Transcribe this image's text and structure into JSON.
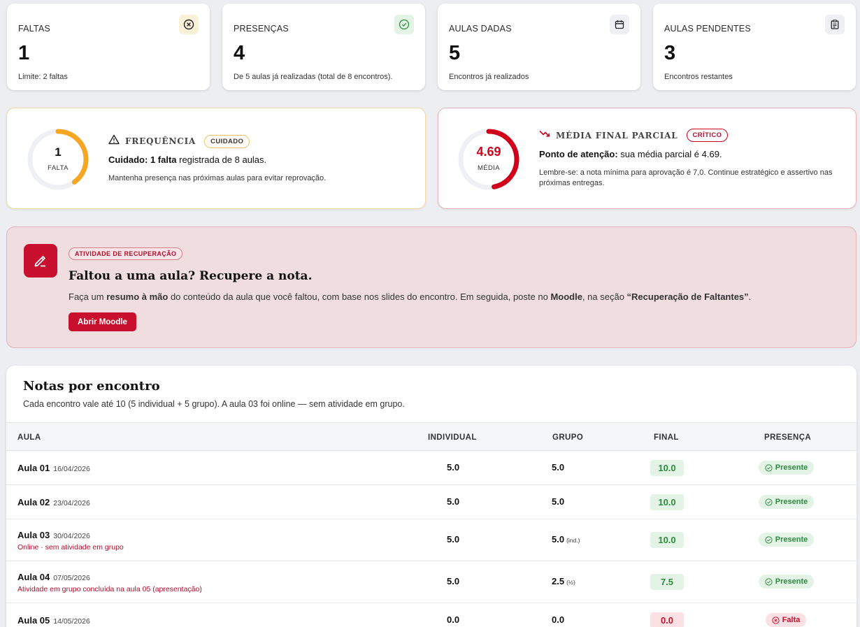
{
  "stats": [
    {
      "label": "FALTAS",
      "value": "1",
      "sub": "Limite: 2 faltas",
      "icon": "x-circle-icon"
    },
    {
      "label": "PRESENÇAS",
      "value": "4",
      "sub": "De 5 aulas já realizadas (total de 8 encontros).",
      "icon": "check-circle-icon"
    },
    {
      "label": "AULAS DADAS",
      "value": "5",
      "sub": "Encontros já realizados",
      "icon": "calendar-icon"
    },
    {
      "label": "AULAS PENDENTES",
      "value": "3",
      "sub": "Encontros restantes",
      "icon": "clipboard-icon"
    }
  ],
  "frequency": {
    "ring_value": "1",
    "ring_caption": "FALTA",
    "ring_fraction": 0.4,
    "title": "FREQUÊNCIA",
    "badge": "CUIDADO",
    "headline_prefix": "Cuidado: ",
    "headline_bold": "1 falta",
    "headline_suffix": " registrada de 8 aulas.",
    "description": "Mantenha presença nas próximas aulas para evitar reprovação.",
    "color": "#f5a623"
  },
  "average": {
    "ring_value": "4.69",
    "ring_caption": "MÉDIA",
    "ring_fraction": 0.469,
    "title": "MÉDIA FINAL PARCIAL",
    "badge": "CRÍTICO",
    "headline_bold": "Ponto de atenção:",
    "headline_suffix": " sua média parcial é 4.69.",
    "description": "Lembre-se: a nota mínima para aprovação é 7,0. Continue estratégico e assertivo nas próximas entregas.",
    "color": "#d0021b"
  },
  "recovery": {
    "badge": "ATIVIDADE DE RECUPERAÇÃO",
    "title": "Faltou a uma aula? Recupere a nota.",
    "text_1": "Faça um ",
    "text_bold_1": "resumo à mão",
    "text_2": " do conteúdo da aula que você faltou, com base nos slides do encontro. Em seguida, poste no ",
    "text_bold_2": "Moodle",
    "text_3": ", na seção ",
    "text_bold_3": "“Recuperação de Faltantes”",
    "text_4": ".",
    "button": "Abrir Moodle"
  },
  "grades": {
    "title": "Notas por encontro",
    "subtitle": "Cada encontro vale até 10 (5 individual + 5 grupo). A aula 03 foi online — sem atividade em grupo.",
    "headers": {
      "aula": "AULA",
      "individual": "INDIVIDUAL",
      "grupo": "GRUPO",
      "final": "FINAL",
      "presenca": "PRESENÇA"
    },
    "rows": [
      {
        "aula": "Aula 01",
        "date": "16/04/2026",
        "note": "",
        "individual": "5.0",
        "grupo": "5.0",
        "tag": "",
        "final": "10.0",
        "presenca": "Presente",
        "status": "ok"
      },
      {
        "aula": "Aula 02",
        "date": "23/04/2026",
        "note": "",
        "individual": "5.0",
        "grupo": "5.0",
        "tag": "",
        "final": "10.0",
        "presenca": "Presente",
        "status": "ok"
      },
      {
        "aula": "Aula 03",
        "date": "30/04/2026",
        "note": "Online · sem atividade em grupo",
        "individual": "5.0",
        "grupo": "5.0",
        "tag": "(ind.)",
        "final": "10.0",
        "presenca": "Presente",
        "status": "ok"
      },
      {
        "aula": "Aula 04",
        "date": "07/05/2026",
        "note": "Atividade em grupo concluída na aula 05 (apresentação)",
        "individual": "5.0",
        "grupo": "2.5",
        "tag": "(½)",
        "final": "7.5",
        "presenca": "Presente",
        "status": "ok"
      },
      {
        "aula": "Aula 05",
        "date": "14/05/2026",
        "note": "",
        "individual": "0.0",
        "grupo": "0.0",
        "tag": "",
        "final": "0.0",
        "presenca": "Falta",
        "status": "fail"
      }
    ]
  },
  "colors": {
    "accent": "#c8102e",
    "success": "#2e8b3e",
    "success_bg": "#e3f4e6",
    "danger_bg": "#fbe1e4",
    "warning": "#f5a623"
  }
}
